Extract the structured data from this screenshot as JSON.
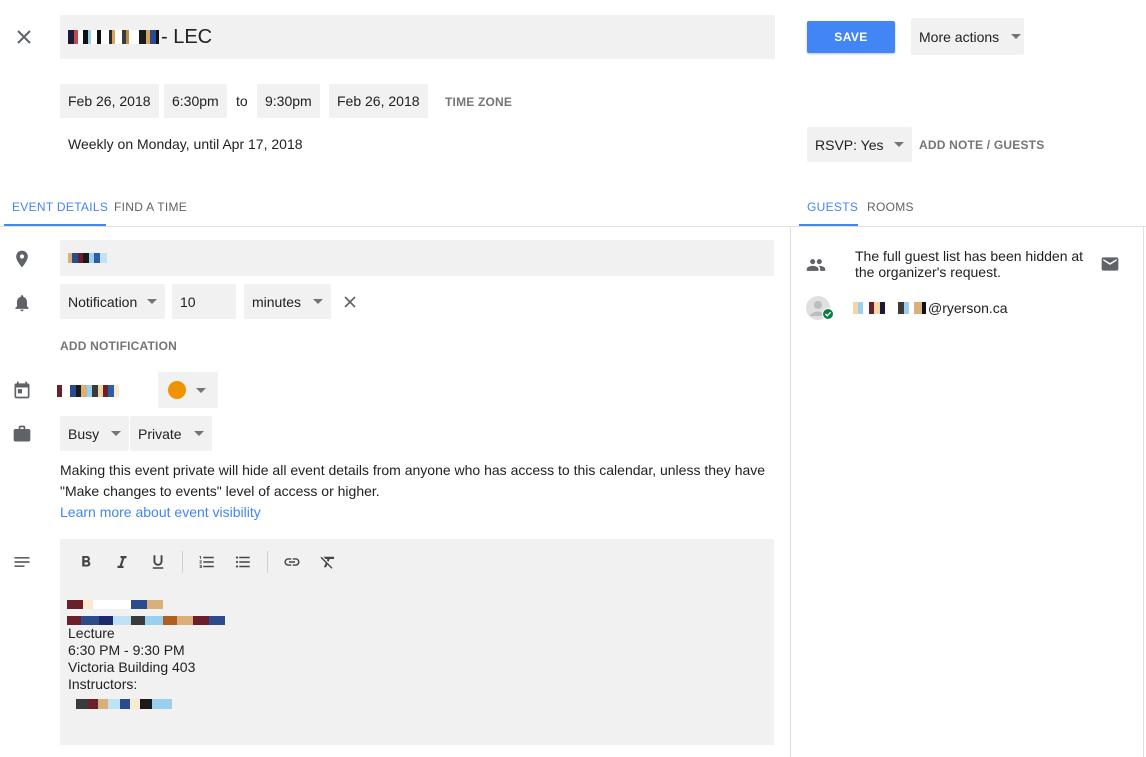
{
  "header": {
    "title_suffix": "- LEC",
    "save_label": "SAVE",
    "more_actions_label": "More actions"
  },
  "schedule": {
    "start_date": "Feb 26, 2018",
    "start_time": "6:30pm",
    "to_label": "to",
    "end_time": "9:30pm",
    "end_date": "Feb 26, 2018",
    "time_zone_label": "TIME ZONE",
    "recurrence": "Weekly on Monday, until Apr 17, 2018"
  },
  "rsvp": {
    "label": "RSVP: Yes",
    "add_note_label": "ADD NOTE / GUESTS"
  },
  "tabs": {
    "left": [
      {
        "label": "EVENT DETAILS",
        "active": true
      },
      {
        "label": "FIND A TIME",
        "active": false
      }
    ],
    "right": [
      {
        "label": "GUESTS",
        "active": true
      },
      {
        "label": "ROOMS",
        "active": false
      }
    ]
  },
  "notification": {
    "type": "Notification",
    "amount": "10",
    "unit": "minutes",
    "add_label": "ADD NOTIFICATION"
  },
  "calendar": {
    "color": "#f09300"
  },
  "visibility": {
    "availability": "Busy",
    "privacy": "Private",
    "notice_line1": "Making this event private will hide all event details from anyone who has access to this calendar, unless they have",
    "notice_line2": "\"Make changes to events\" level of access or higher.",
    "learn_more": "Learn more about event visibility"
  },
  "description": {
    "lines": [
      "Lecture",
      "6:30 PM - 9:30 PM",
      "Victoria Building 403",
      "Instructors:"
    ]
  },
  "guests": {
    "hidden_notice_line1": "The full guest list has been hidden at",
    "hidden_notice_line2": "the organizer's request.",
    "guest_email_suffix": "@ryerson.ca"
  },
  "icons": {
    "close": "close-icon",
    "location": "location-pin-icon",
    "notification": "bell-icon",
    "calendar": "calendar-icon",
    "visibility": "briefcase-icon",
    "description": "notes-icon",
    "people": "people-icon",
    "email": "email-icon"
  },
  "colors": {
    "accent": "#4285f4",
    "chip_bg": "#f1f1f1",
    "calendar_dot": "#f09300",
    "accepted": "#0b8043"
  }
}
